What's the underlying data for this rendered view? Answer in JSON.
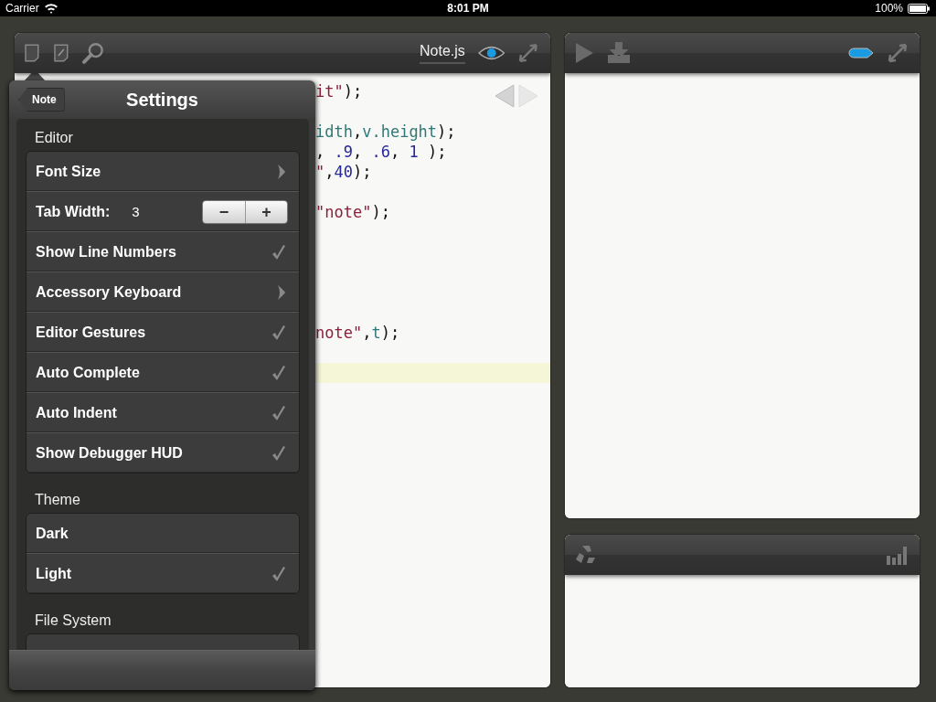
{
  "status_bar": {
    "carrier": "Carrier",
    "time": "8:01 PM",
    "battery": "100%"
  },
  "editor": {
    "title": "Note.js",
    "lines": [
      {
        "kind": "code",
        "current": false,
        "tokens": [
          {
            "kind": "string",
            "text": "it\""
          },
          {
            "kind": "plain",
            "text": ");"
          }
        ]
      },
      {
        "kind": "blank",
        "current": false
      },
      {
        "kind": "code",
        "current": false,
        "tokens": [
          {
            "kind": "ident",
            "text": "idth"
          },
          {
            "kind": "plain",
            "text": ","
          },
          {
            "kind": "ident",
            "text": "v.height"
          },
          {
            "kind": "plain",
            "text": ");"
          }
        ]
      },
      {
        "kind": "code",
        "current": false,
        "tokens": [
          {
            "kind": "plain",
            "text": ", "
          },
          {
            "kind": "number",
            "text": ".9"
          },
          {
            "kind": "plain",
            "text": ", "
          },
          {
            "kind": "number",
            "text": ".6"
          },
          {
            "kind": "plain",
            "text": ", "
          },
          {
            "kind": "number",
            "text": "1"
          },
          {
            "kind": "plain",
            "text": " );"
          }
        ]
      },
      {
        "kind": "code",
        "current": false,
        "tokens": [
          {
            "kind": "string",
            "text": "\""
          },
          {
            "kind": "plain",
            "text": ","
          },
          {
            "kind": "number",
            "text": "40"
          },
          {
            "kind": "plain",
            "text": ");"
          }
        ]
      },
      {
        "kind": "blank",
        "current": false
      },
      {
        "kind": "code",
        "current": false,
        "tokens": [
          {
            "kind": "string",
            "text": "\"note\""
          },
          {
            "kind": "plain",
            "text": ");"
          }
        ]
      },
      {
        "kind": "blank",
        "current": false
      },
      {
        "kind": "blank",
        "current": false
      },
      {
        "kind": "blank",
        "current": false
      },
      {
        "kind": "blank",
        "current": false
      },
      {
        "kind": "blank",
        "current": false
      },
      {
        "kind": "code",
        "current": false,
        "tokens": [
          {
            "kind": "string",
            "text": "note\""
          },
          {
            "kind": "plain",
            "text": ","
          },
          {
            "kind": "ident",
            "text": "t"
          },
          {
            "kind": "plain",
            "text": ");"
          }
        ]
      },
      {
        "kind": "blank",
        "current": false
      },
      {
        "kind": "blank",
        "current": true
      }
    ]
  },
  "settings": {
    "back": "Note",
    "title": "Settings",
    "groups": [
      {
        "label": "Editor",
        "rows": [
          {
            "kind": "disclosure",
            "label": "Font Size"
          },
          {
            "kind": "stepper",
            "label": "Tab Width:",
            "value": "3",
            "decrement": "−",
            "increment": "+"
          },
          {
            "kind": "check",
            "label": "Show Line Numbers",
            "checked": true
          },
          {
            "kind": "disclosure",
            "label": "Accessory Keyboard"
          },
          {
            "kind": "check",
            "label": "Editor Gestures",
            "checked": true
          },
          {
            "kind": "check",
            "label": "Auto Complete",
            "checked": true
          },
          {
            "kind": "check",
            "label": "Auto Indent",
            "checked": true
          },
          {
            "kind": "check",
            "label": "Show Debugger HUD",
            "checked": true
          }
        ]
      },
      {
        "label": "Theme",
        "rows": [
          {
            "kind": "check",
            "label": "Dark",
            "checked": false
          },
          {
            "kind": "check",
            "label": "Light",
            "checked": true
          }
        ]
      },
      {
        "label": "File System"
      }
    ]
  }
}
